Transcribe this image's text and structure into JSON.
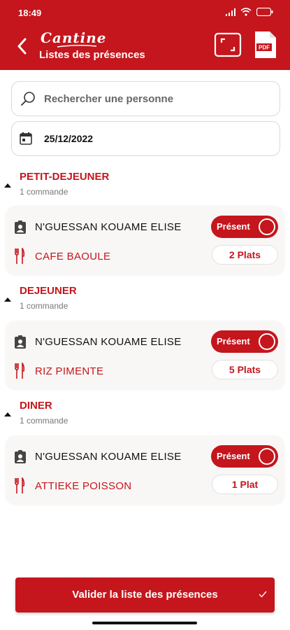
{
  "status_bar": {
    "time": "18:49"
  },
  "header": {
    "brand": "Cantine",
    "title": "Listes des présences",
    "pdf_label": "PDF",
    "icons": {
      "back": "chevron-left-icon",
      "expand": "fullscreen-icon",
      "pdf": "pdf-file-icon"
    }
  },
  "search": {
    "placeholder": "Rechercher une personne",
    "value": ""
  },
  "date": {
    "value": "25/12/2022"
  },
  "sections": [
    {
      "title": "PETIT-DEJEUNER",
      "count": "1 commande",
      "card": {
        "person": "N'GUESSAN KOUAME ELISE",
        "status": "Présent",
        "dish": "CAFE BAOULE",
        "quantity": "2 Plats"
      }
    },
    {
      "title": "DEJEUNER",
      "count": "1 commande",
      "card": {
        "person": "N'GUESSAN KOUAME ELISE",
        "status": "Présent",
        "dish": "RIZ PIMENTE",
        "quantity": "5 Plats"
      }
    },
    {
      "title": "DINER",
      "count": "1 commande",
      "card": {
        "person": "N'GUESSAN KOUAME ELISE",
        "status": "Présent",
        "dish": "ATTIEKE POISSON",
        "quantity": "1 Plat"
      }
    }
  ],
  "validate_button": {
    "label": "Valider la liste des présences"
  },
  "colors": {
    "primary": "#c4161c",
    "background": "#ffffff",
    "card": "#f8f7f6"
  }
}
